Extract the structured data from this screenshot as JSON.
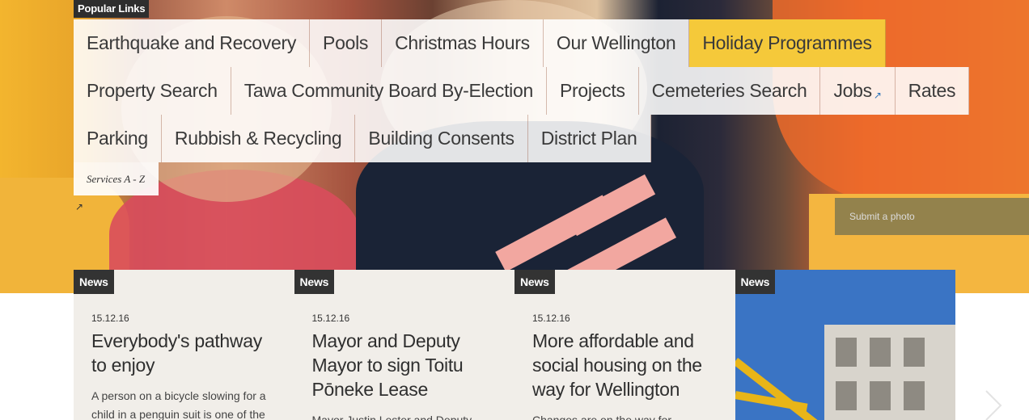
{
  "popular_links": {
    "label": "Popular Links",
    "row1": [
      {
        "label": "Earthquake and Recovery"
      },
      {
        "label": "Pools"
      },
      {
        "label": "Christmas Hours"
      },
      {
        "label": "Our Wellington"
      },
      {
        "label": "Holiday Programmes",
        "highlight": true
      }
    ],
    "row2": [
      {
        "label": "Property Search"
      },
      {
        "label": "Tawa Community Board By-Election"
      },
      {
        "label": "Projects"
      },
      {
        "label": "Cemeteries Search"
      },
      {
        "label": "Jobs",
        "external": true
      },
      {
        "label": "Rates"
      }
    ],
    "row3": [
      {
        "label": "Parking"
      },
      {
        "label": "Rubbish & Recycling"
      },
      {
        "label": "Building Consents"
      },
      {
        "label": "District Plan"
      }
    ],
    "services_az": "Services A - Z",
    "external_icon": "↗"
  },
  "hero": {
    "submit_photo": "Submit a photo"
  },
  "news": [
    {
      "tag": "News",
      "date": "15.12.16",
      "title": "Everybody's pathway to enjoy",
      "excerpt": "A person on a bicycle slowing for a child in a penguin suit is one of the"
    },
    {
      "tag": "News",
      "date": "15.12.16",
      "title": "Mayor and Deputy Mayor to sign Toitu Pōneke Lease",
      "excerpt": "Mayor Justin Lester and Deputy"
    },
    {
      "tag": "News",
      "date": "15.12.16",
      "title": "More affordable and social housing on the way for Wellington",
      "excerpt": "Changes are on the way for"
    },
    {
      "tag": "News",
      "image": "demolition-building-photo"
    }
  ],
  "icons": {
    "external_link": "external-link-icon",
    "next": "chevron-right-icon"
  },
  "colors": {
    "highlight": "#f5c93a",
    "tag_bg": "#333333",
    "card_bg": "#f1eee9"
  }
}
